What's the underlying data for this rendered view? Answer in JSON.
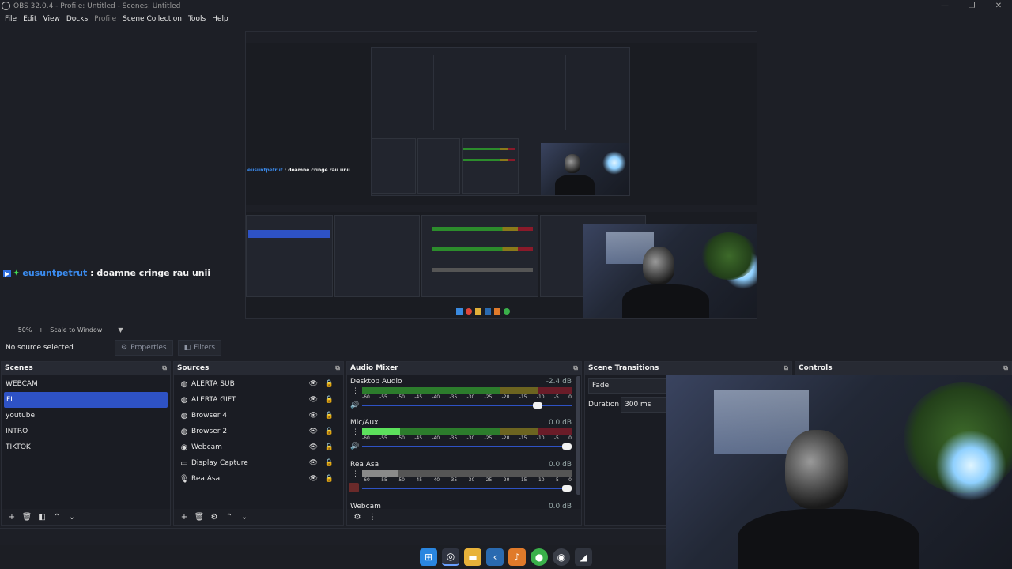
{
  "window": {
    "title": "OBS 32.0.4 - Profile: Untitled - Scenes: Untitled",
    "minimize": "—",
    "maximize": "❐",
    "close": "✕"
  },
  "menu": {
    "file": "File",
    "edit": "Edit",
    "view": "View",
    "docks": "Docks",
    "profile": "Profile",
    "scene_collection": "Scene Collection",
    "tools": "Tools",
    "help": "Help"
  },
  "preview": {
    "chat_badge": "▶",
    "chat_spark": "✦",
    "chat_user": "eusuntpetrut",
    "chat_sep": " : ",
    "chat_text": "doamne cringe rau unii"
  },
  "zoom": {
    "minus": "−",
    "value": "50%",
    "plus": "+",
    "mode": "Scale to Window",
    "dropdown": "▼"
  },
  "source_toolbar": {
    "no_source": "No source selected",
    "properties": "Properties",
    "filters": "Filters"
  },
  "scenes": {
    "title": "Scenes",
    "items": [
      "WEBCAM",
      "FL",
      "youtube",
      "INTRO",
      "TIKTOK"
    ],
    "selected": "FL"
  },
  "sources": {
    "title": "Sources",
    "items": [
      {
        "label": "ALERTA SUB",
        "icon": "globe-icon"
      },
      {
        "label": "ALERTA GIFT",
        "icon": "globe-icon"
      },
      {
        "label": "Browser 4",
        "icon": "globe-icon"
      },
      {
        "label": "Browser 2",
        "icon": "globe-icon"
      },
      {
        "label": "Webcam",
        "icon": "camera-icon"
      },
      {
        "label": "Display Capture",
        "icon": "monitor-icon"
      },
      {
        "label": "Rea Asa",
        "icon": "microphone-icon"
      }
    ]
  },
  "mixer": {
    "title": "Audio Mixer",
    "ticks": [
      "-60",
      "-55",
      "-50",
      "-45",
      "-40",
      "-35",
      "-30",
      "-25",
      "-20",
      "-15",
      "-10",
      "-5",
      "0"
    ],
    "channels": [
      {
        "name": "Desktop Audio",
        "db": "-2.4 dB",
        "level": 0,
        "fader": 0.86,
        "muted": false
      },
      {
        "name": "Mic/Aux",
        "db": "0.0 dB",
        "level": 0.18,
        "fader": 1.0,
        "muted": false
      },
      {
        "name": "Rea Asa",
        "db": "0.0 dB",
        "level": 0.17,
        "fader": 1.0,
        "muted": true
      },
      {
        "name": "Webcam",
        "db": "0.0 dB"
      }
    ]
  },
  "transitions": {
    "title": "Scene Transitions",
    "selected": "Fade",
    "duration_label": "Duration",
    "duration": "300 ms"
  },
  "controls": {
    "title": "Controls"
  },
  "colors": {
    "accent": "#2e52c4",
    "background": "#1d1f26",
    "dock_title": "#272a33"
  }
}
